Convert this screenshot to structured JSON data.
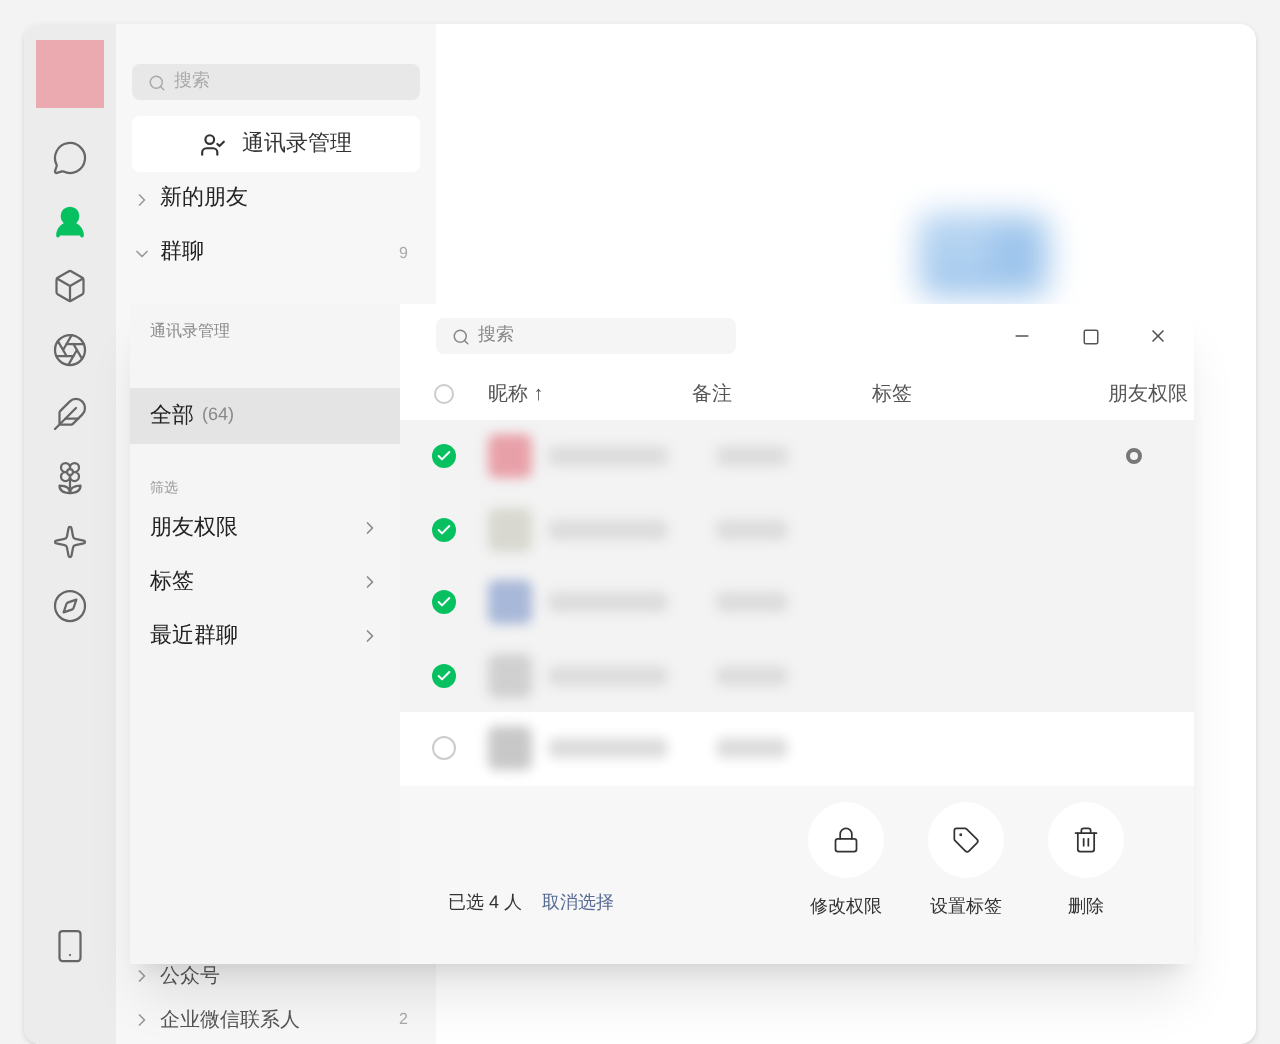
{
  "sidebar": {
    "items": [
      {
        "selected": false
      },
      {
        "selected": true
      },
      {
        "selected": false
      },
      {
        "selected": false
      },
      {
        "selected": false
      },
      {
        "selected": false
      },
      {
        "selected": false
      },
      {
        "selected": false
      }
    ]
  },
  "contacts": {
    "search": {
      "placeholder": "搜索"
    },
    "manage_button": "通讯录管理",
    "groups": [
      {
        "label": "新的朋友",
        "expanded": false
      },
      {
        "label": "群聊",
        "expanded": true,
        "count": "9"
      }
    ],
    "bottom_groups": [
      {
        "label": "公众号"
      },
      {
        "label": "企业微信联系人",
        "count": "2"
      }
    ]
  },
  "dialog": {
    "title": "通讯录管理",
    "nav": [
      {
        "label": "全部",
        "count": "(64)",
        "selected": true
      }
    ],
    "filter_heading": "筛选",
    "filters": [
      {
        "label": "朋友权限"
      },
      {
        "label": "标签"
      },
      {
        "label": "最近群聊"
      }
    ],
    "search": {
      "placeholder": "搜索"
    },
    "all_checked": false,
    "columns": [
      "昵称 ↑",
      "备注",
      "标签",
      "朋友权限"
    ],
    "rows": [
      {
        "checked": true,
        "color": "#e8a0a8",
        "has_permission_icon": true
      },
      {
        "checked": true,
        "color": "#d8d8d0",
        "has_permission_icon": false
      },
      {
        "checked": true,
        "color": "#a8b8d8",
        "has_permission_icon": false
      },
      {
        "checked": true,
        "color": "#d0d0d0",
        "has_permission_icon": false
      },
      {
        "checked": false,
        "color": "#c8c8c8",
        "has_permission_icon": false
      }
    ],
    "selection_prefix": "已选",
    "selection_count": "4",
    "selection_suffix": "人",
    "clear_link": "取消选择",
    "actions": [
      {
        "kind": "lock",
        "label": "修改权限"
      },
      {
        "kind": "tag",
        "label": "设置标签"
      },
      {
        "kind": "trash",
        "label": "删除"
      }
    ]
  }
}
